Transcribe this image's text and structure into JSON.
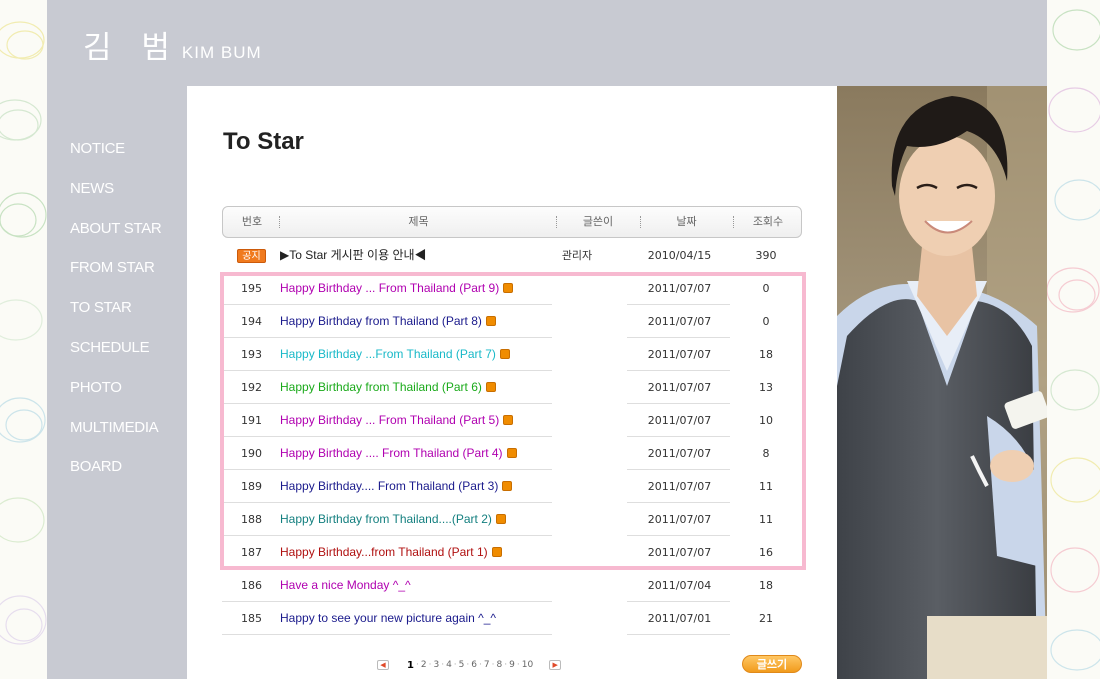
{
  "site": {
    "logo_ko": "김 범",
    "logo_en": "KIM BUM"
  },
  "nav": {
    "items": [
      "NOTICE",
      "NEWS",
      "ABOUT STAR",
      "FROM STAR",
      "TO STAR",
      "SCHEDULE",
      "PHOTO",
      "MULTIMEDIA",
      "BOARD"
    ]
  },
  "page": {
    "title": "To Star"
  },
  "table": {
    "headers": {
      "no": "번호",
      "title": "제목",
      "author": "글쓴이",
      "date": "날짜",
      "views": "조회수"
    },
    "notice": {
      "badge": "공지",
      "title": "▶To Star 게시판 이용 안내◀",
      "author": "관리자",
      "date": "2010/04/15",
      "views": "390"
    },
    "rows": [
      {
        "no": "195",
        "title": "Happy Birthday ... From Thailand (Part 9)",
        "date": "2011/07/07",
        "views": "0",
        "color": "#b000b0",
        "new": true
      },
      {
        "no": "194",
        "title": "Happy Birthday from Thailand (Part 8)",
        "date": "2011/07/07",
        "views": "0",
        "color": "#1a1a8c",
        "new": true
      },
      {
        "no": "193",
        "title": "Happy Birthday ...From Thailand (Part 7)",
        "date": "2011/07/07",
        "views": "18",
        "color": "#19b9c8",
        "new": true
      },
      {
        "no": "192",
        "title": "Happy Birthday from Thailand (Part 6)",
        "date": "2011/07/07",
        "views": "13",
        "color": "#1aaa1a",
        "new": true
      },
      {
        "no": "191",
        "title": "Happy Birthday ... From Thailand (Part 5)",
        "date": "2011/07/07",
        "views": "10",
        "color": "#b000b0",
        "new": true
      },
      {
        "no": "190",
        "title": "Happy Birthday .... From Thailand (Part 4)",
        "date": "2011/07/07",
        "views": "8",
        "color": "#b000b0",
        "new": true
      },
      {
        "no": "189",
        "title": "Happy Birthday.... From Thailand (Part 3)",
        "date": "2011/07/07",
        "views": "11",
        "color": "#1a1a8c",
        "new": true
      },
      {
        "no": "188",
        "title": "Happy Birthday from Thailand....(Part 2)",
        "date": "2011/07/07",
        "views": "11",
        "color": "#137f7f",
        "new": true
      },
      {
        "no": "187",
        "title": "Happy Birthday...from Thailand (Part 1)",
        "date": "2011/07/07",
        "views": "16",
        "color": "#b01010",
        "new": true
      },
      {
        "no": "186",
        "title": "Have a nice Monday ^_^",
        "date": "2011/07/04",
        "views": "18",
        "color": "#b000b0",
        "new": false
      },
      {
        "no": "185",
        "title": "Happy to see your new picture again ^_^",
        "date": "2011/07/01",
        "views": "21",
        "color": "#1a1a8c",
        "new": false
      }
    ]
  },
  "pager": {
    "prev": "◀",
    "next": "▶",
    "pages": [
      "1",
      "2",
      "3",
      "4",
      "5",
      "6",
      "7",
      "8",
      "9",
      "10"
    ],
    "current": "1"
  },
  "write_button": "글쓰기",
  "colors": {
    "header_bg": "#c8cad2",
    "highlight": "#f7b9d0",
    "accent": "#f19b1d"
  }
}
